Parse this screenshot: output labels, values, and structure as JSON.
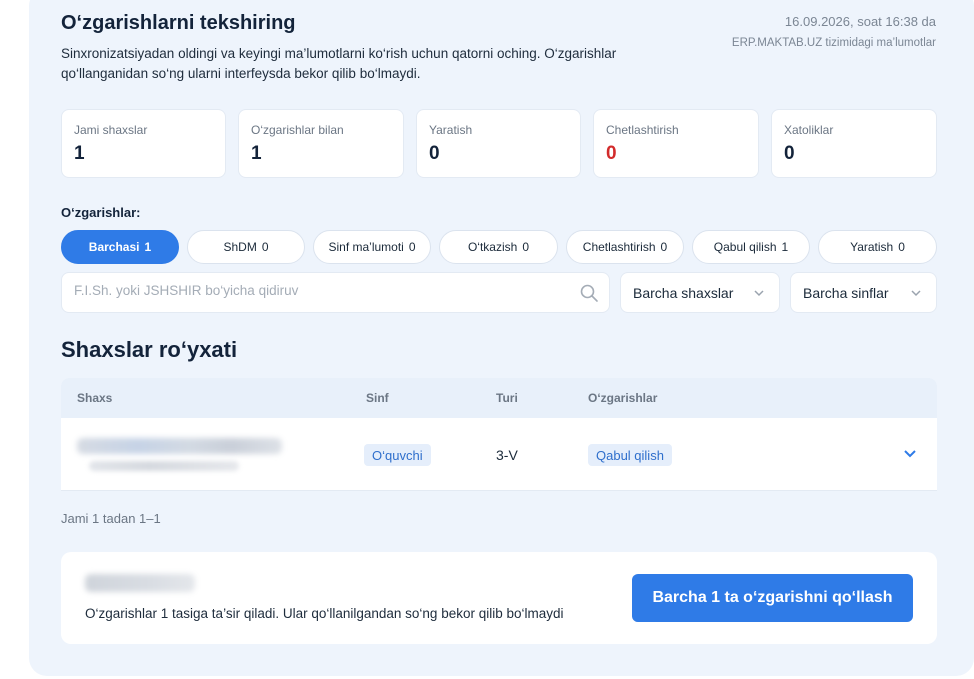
{
  "header": {
    "title": "O‘zgarishlarni tekshiring",
    "subtitle": "Sinxronizatsiyadan oldingi va keyingi ma’lumotlarni ko‘rish uchun qatorni oching. O‘zgarishlar qo‘llanganidan so‘ng ularni interfeysda bekor qilib bo‘lmaydi.",
    "date": "16.09.2026, soat 16:38 da",
    "source": "ERP.MAKTAB.UZ tizimidagi ma’lumotlar"
  },
  "stats": [
    {
      "label": "Jami shaxslar",
      "value": "1"
    },
    {
      "label": "O‘zgarishlar bilan",
      "value": "1"
    },
    {
      "label": "Yaratish",
      "value": "0"
    },
    {
      "label": "Chetlashtirish",
      "value": "0"
    },
    {
      "label": "Xatoliklar",
      "value": "0"
    }
  ],
  "filters": {
    "label": "O‘zgarishlar:",
    "chips": [
      {
        "label": "Barchasi",
        "count": "1"
      },
      {
        "label": "ShDM",
        "count": "0"
      },
      {
        "label": "Sinf ma’lumoti",
        "count": "0"
      },
      {
        "label": "O‘tkazish",
        "count": "0"
      },
      {
        "label": "Chetlashtirish",
        "count": "0"
      },
      {
        "label": "Qabul qilish",
        "count": "1"
      },
      {
        "label": "Yaratish",
        "count": "0"
      }
    ],
    "search_placeholder": "F.I.Sh. yoki JSHSHIR bo‘yicha qidiruv",
    "persons_select": "Barcha shaxslar",
    "classes_select": "Barcha sinflar"
  },
  "list": {
    "title": "Shaxslar ro‘yxati",
    "columns": [
      "Shaxs",
      "Sinf",
      "Turi",
      "O‘zgarishlar"
    ],
    "rows": [
      {
        "sinf": "O‘quvchi",
        "turi": "3-V",
        "change": "Qabul qilish"
      }
    ],
    "pagination": "Jami 1 tadan 1–1"
  },
  "footer": {
    "note": "O‘zgarishlar 1 tasiga ta’sir qiladi. Ular qo‘llanilgandan so‘ng bekor qilib bo‘lmaydi",
    "apply_label": "Barcha 1 ta o‘zgarishni qo‘llash"
  },
  "colors": {
    "accent": "#2f7be7",
    "panel_bg": "#eef4fc",
    "danger": "#d22b2b"
  },
  "icons": [
    "search-icon",
    "chevron-down-icon"
  ]
}
